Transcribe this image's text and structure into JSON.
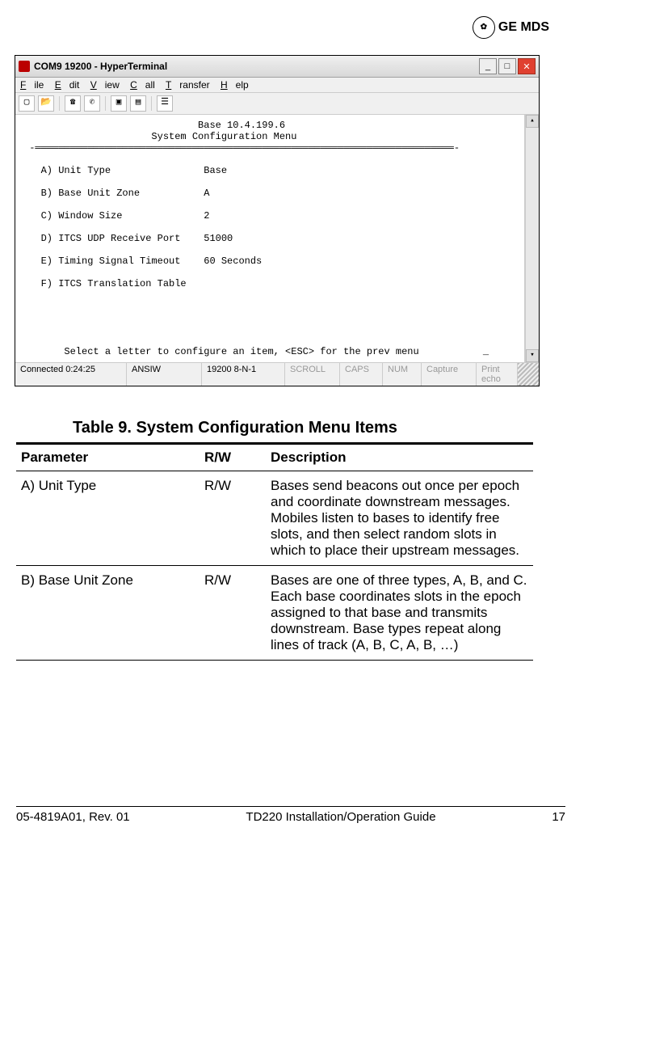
{
  "brand": {
    "name": "GE MDS",
    "logo_mark": "⅊"
  },
  "window": {
    "title": "COM9 19200 - HyperTerminal",
    "menus": [
      "File",
      "Edit",
      "View",
      "Call",
      "Transfer",
      "Help"
    ],
    "toolbar_icons": [
      "new-icon",
      "open-icon",
      "connect-icon",
      "disconnect-icon",
      "sep",
      "send-icon",
      "receive-icon",
      "sep",
      "properties-icon"
    ],
    "terminal": {
      "header_line1": "Base 10.4.199.6",
      "header_line2": "System Configuration Menu",
      "items": [
        {
          "key": "A) Unit Type",
          "value": "Base"
        },
        {
          "key": "B) Base Unit Zone",
          "value": "A"
        },
        {
          "key": "C) Window Size",
          "value": "2"
        },
        {
          "key": "D) ITCS UDP Receive Port",
          "value": "51000"
        },
        {
          "key": "E) Timing Signal Timeout",
          "value": "60 Seconds"
        },
        {
          "key": "F) ITCS Translation Table",
          "value": ""
        }
      ],
      "footer_prompt": "Select a letter to configure an item, <ESC> for the prev menu"
    },
    "status": {
      "connected": "Connected 0:24:25",
      "emu": "ANSIW",
      "params": "19200 8-N-1",
      "scroll": "SCROLL",
      "caps": "CAPS",
      "num": "NUM",
      "capture": "Capture",
      "printecho": "Print echo"
    }
  },
  "table": {
    "caption": "Table 9. System Configuration Menu Items",
    "headers": {
      "param": "Parameter",
      "rw": "R/W",
      "desc": "Description"
    },
    "rows": [
      {
        "param": "A) Unit Type",
        "rw": "R/W",
        "desc": "Bases send beacons out once per epoch and coordinate downstream messages. Mobiles listen to bases to identify free slots, and then select random slots in which to place their upstream messages."
      },
      {
        "param": "B) Base Unit Zone",
        "rw": "R/W",
        "desc": "Bases are one of three types, A, B, and C. Each base coordinates slots in the epoch assigned to that base and transmits downstream. Base types repeat along lines of track (A, B, C, A, B, …)"
      }
    ]
  },
  "footer": {
    "left": "05-4819A01, Rev. 01",
    "center": "TD220 Installation/Operation Guide",
    "page": "17"
  }
}
